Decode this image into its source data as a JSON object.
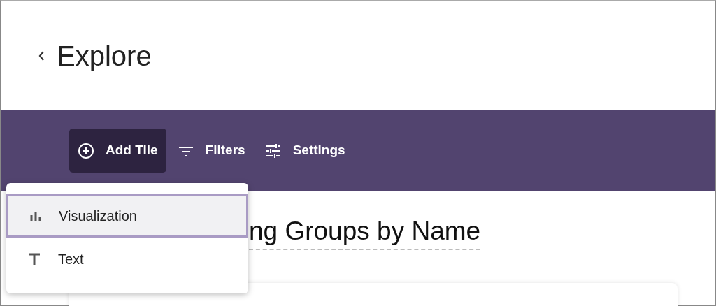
{
  "header": {
    "title": "Explore"
  },
  "toolbar": {
    "buttons": [
      {
        "label": "Add Tile",
        "kind": "add",
        "selected": true
      },
      {
        "label": "Filters",
        "kind": "filter",
        "selected": false
      },
      {
        "label": "Settings",
        "kind": "settings",
        "selected": false
      }
    ]
  },
  "add_tile_menu": {
    "items": [
      {
        "label": "Visualization",
        "kind": "visualization",
        "selected": true
      },
      {
        "label": "Text",
        "kind": "text",
        "selected": false
      }
    ]
  },
  "dashboard": {
    "title": "ng Groups by Name"
  }
}
